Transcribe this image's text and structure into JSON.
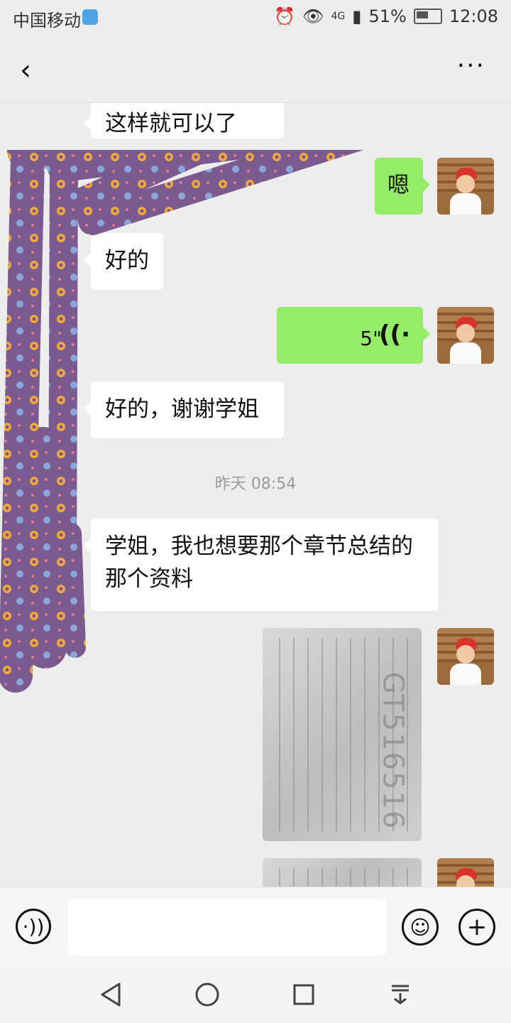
{
  "status_bar": {
    "carrier": "中国移动",
    "network": "4G",
    "battery": "51%",
    "time": "12:08"
  },
  "nav": {
    "title": "",
    "more_label": "···"
  },
  "messages": {
    "top_partial": "这样就可以了",
    "m1": "嗯",
    "m2": "好的",
    "voice_duration": "5\"",
    "m3": "好的，谢谢学姐",
    "timestamp": "昨天 08:54",
    "m4": "学姐，我也想要那个章节总结的那个资料",
    "doc_watermark": "GT516516"
  },
  "input": {
    "placeholder": ""
  },
  "icons": {
    "back": "back-arrow-icon",
    "more": "more-icon",
    "voice": "voice-input-icon",
    "emoji": "emoji-icon",
    "plus": "plus-icon",
    "sys_back": "back-triangle-icon",
    "sys_home": "home-circle-icon",
    "sys_recent": "recent-square-icon",
    "sys_menu": "notification-icon"
  },
  "colors": {
    "background": "#ededed",
    "bubble_out": "#95ec69",
    "bubble_in": "#ffffff",
    "scribble": "#7b5a8f"
  }
}
